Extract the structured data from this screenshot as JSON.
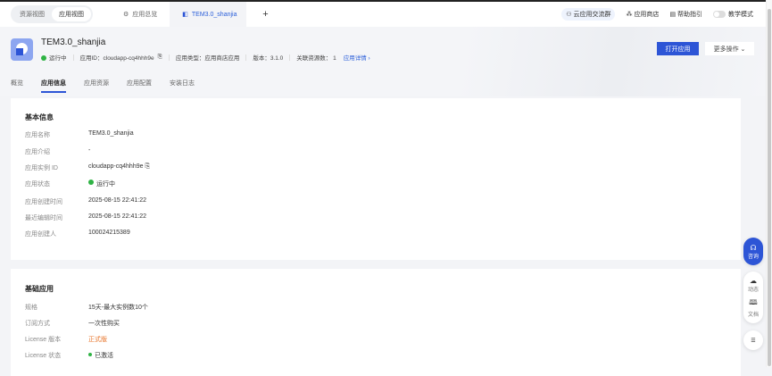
{
  "topbar": {
    "view_toggle": [
      "资源视图",
      "应用视图"
    ],
    "tabs": [
      "应用总览",
      "TEM3.0_shanjia"
    ],
    "plus": "+",
    "right": [
      "云应用交流群",
      "应用商店",
      "帮助指引",
      "教学模式"
    ]
  },
  "header": {
    "title": "TEM3.0_shanjia",
    "status": "运行中",
    "app_id": "应用ID：cloudapp-cq4hhh9e",
    "app_type": "应用类型：应用商店应用",
    "version": "版本：3.1.0",
    "resources": "关联资源数： 1",
    "detail_link": "应用详情 ›",
    "open_button": "打开应用",
    "more_button": "更多操作 ⌄"
  },
  "tabs": [
    "概览",
    "应用信息",
    "应用资源",
    "应用配置",
    "安装日志"
  ],
  "basic": {
    "title": "基本信息",
    "rows": [
      {
        "k": "应用名称",
        "v": "TEM3.0_shanjia"
      },
      {
        "k": "应用介绍",
        "v": "-"
      },
      {
        "k": "应用实例 ID",
        "v": "cloudapp-cq4hhh9e"
      },
      {
        "k": "应用状态",
        "v": "运行中"
      },
      {
        "k": "应用创建时间",
        "v": "2025-08-15 22:41:22"
      },
      {
        "k": "最近编辑时间",
        "v": "2025-08-15 22:41:22"
      },
      {
        "k": "应用创建人",
        "v": "100024215389"
      }
    ]
  },
  "base_app": {
    "title": "基础应用",
    "rows": [
      {
        "k": "规格",
        "v": "15天-最大实例数10个"
      },
      {
        "k": "订阅方式",
        "v": "一次性购买"
      },
      {
        "k": "License 版本",
        "v": "正式版"
      },
      {
        "k": "License 状态",
        "v": "已激活"
      }
    ]
  },
  "float": {
    "consult": "咨询",
    "news": "动态",
    "docs": "文档"
  }
}
